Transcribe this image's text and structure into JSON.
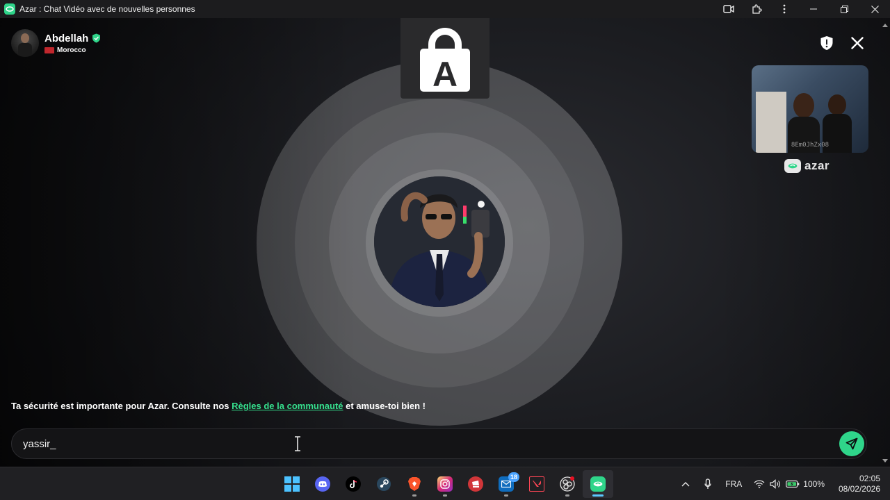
{
  "window": {
    "title": "Azar : Chat Vidéo avec de nouvelles personnes"
  },
  "partner": {
    "name": "Abdellah",
    "country": "Morocco"
  },
  "self_preview": {
    "overlay_code": "8Em0JhZx08"
  },
  "brand": {
    "wordmark": "azar",
    "lock_letter": "A"
  },
  "notice": {
    "prefix": "Ta sécurité est importante pour Azar. Consulte nos ",
    "link": "Règles de la communauté",
    "suffix": " et amuse-toi bien !"
  },
  "chat": {
    "input_value": "yassir_"
  },
  "taskbar": {
    "apps": [
      {
        "name": "start",
        "icon": "windows-icon"
      },
      {
        "name": "discord",
        "icon": "discord-icon"
      },
      {
        "name": "tiktok",
        "icon": "tiktok-icon"
      },
      {
        "name": "steam",
        "icon": "steam-icon"
      },
      {
        "name": "brave",
        "icon": "brave-icon"
      },
      {
        "name": "instagram",
        "icon": "instagram-icon"
      },
      {
        "name": "riot",
        "icon": "riot-icon"
      },
      {
        "name": "mail",
        "icon": "mail-icon",
        "badge": "18"
      },
      {
        "name": "valorant",
        "icon": "valorant-icon"
      },
      {
        "name": "obs",
        "icon": "obs-icon"
      },
      {
        "name": "azar",
        "icon": "azar-icon"
      }
    ],
    "tray": {
      "language": "FRA",
      "battery": "100%",
      "time": "02:05",
      "date": "08/02/2026"
    }
  },
  "colors": {
    "accent": "#2fd58a",
    "link": "#36e08e",
    "flag": "#c1272d",
    "badge": "#4aa3ff"
  }
}
